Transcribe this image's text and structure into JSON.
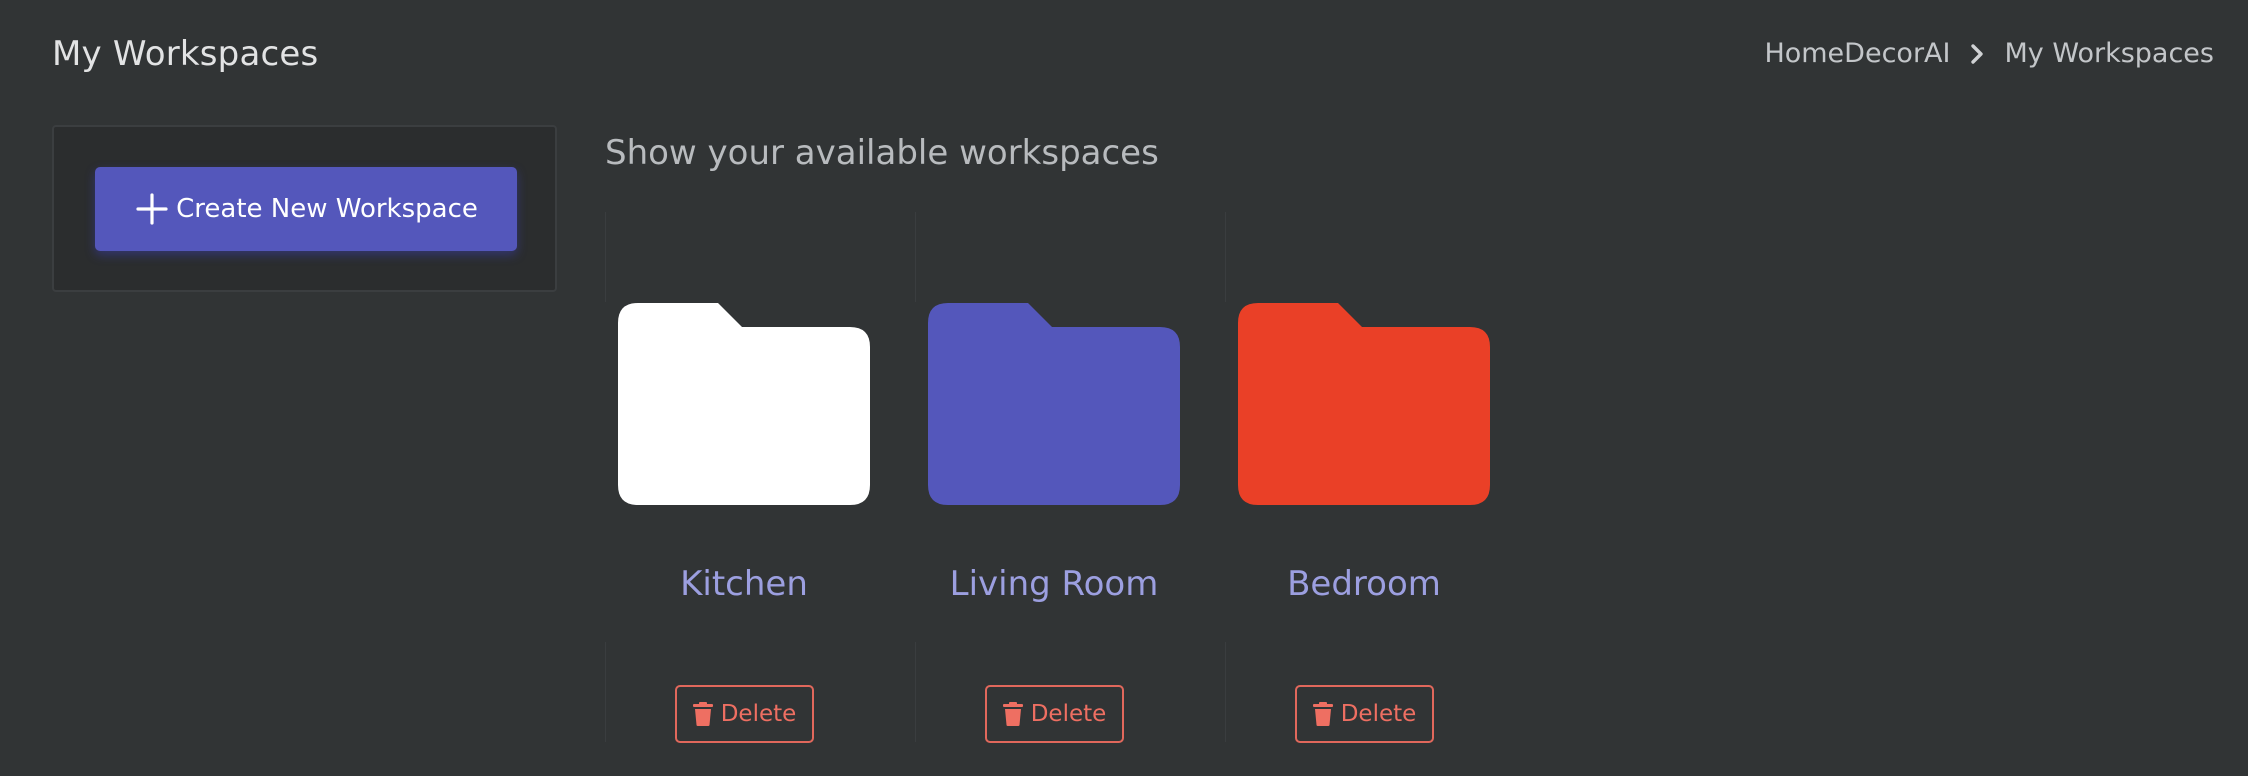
{
  "header": {
    "title": "My Workspaces",
    "breadcrumb": [
      "HomeDecorAI",
      "My Workspaces"
    ]
  },
  "sidebar": {
    "create_button_label": "Create New Workspace"
  },
  "main": {
    "subtitle": "Show your available workspaces",
    "delete_label": "Delete",
    "workspaces": [
      {
        "name": "Kitchen",
        "color": "#ffffff"
      },
      {
        "name": "Living Room",
        "color": "#5457bb"
      },
      {
        "name": "Bedroom",
        "color": "#ea4027"
      }
    ]
  },
  "colors": {
    "accent": "#5457bb",
    "danger": "#ee6f62",
    "background": "#313435"
  }
}
